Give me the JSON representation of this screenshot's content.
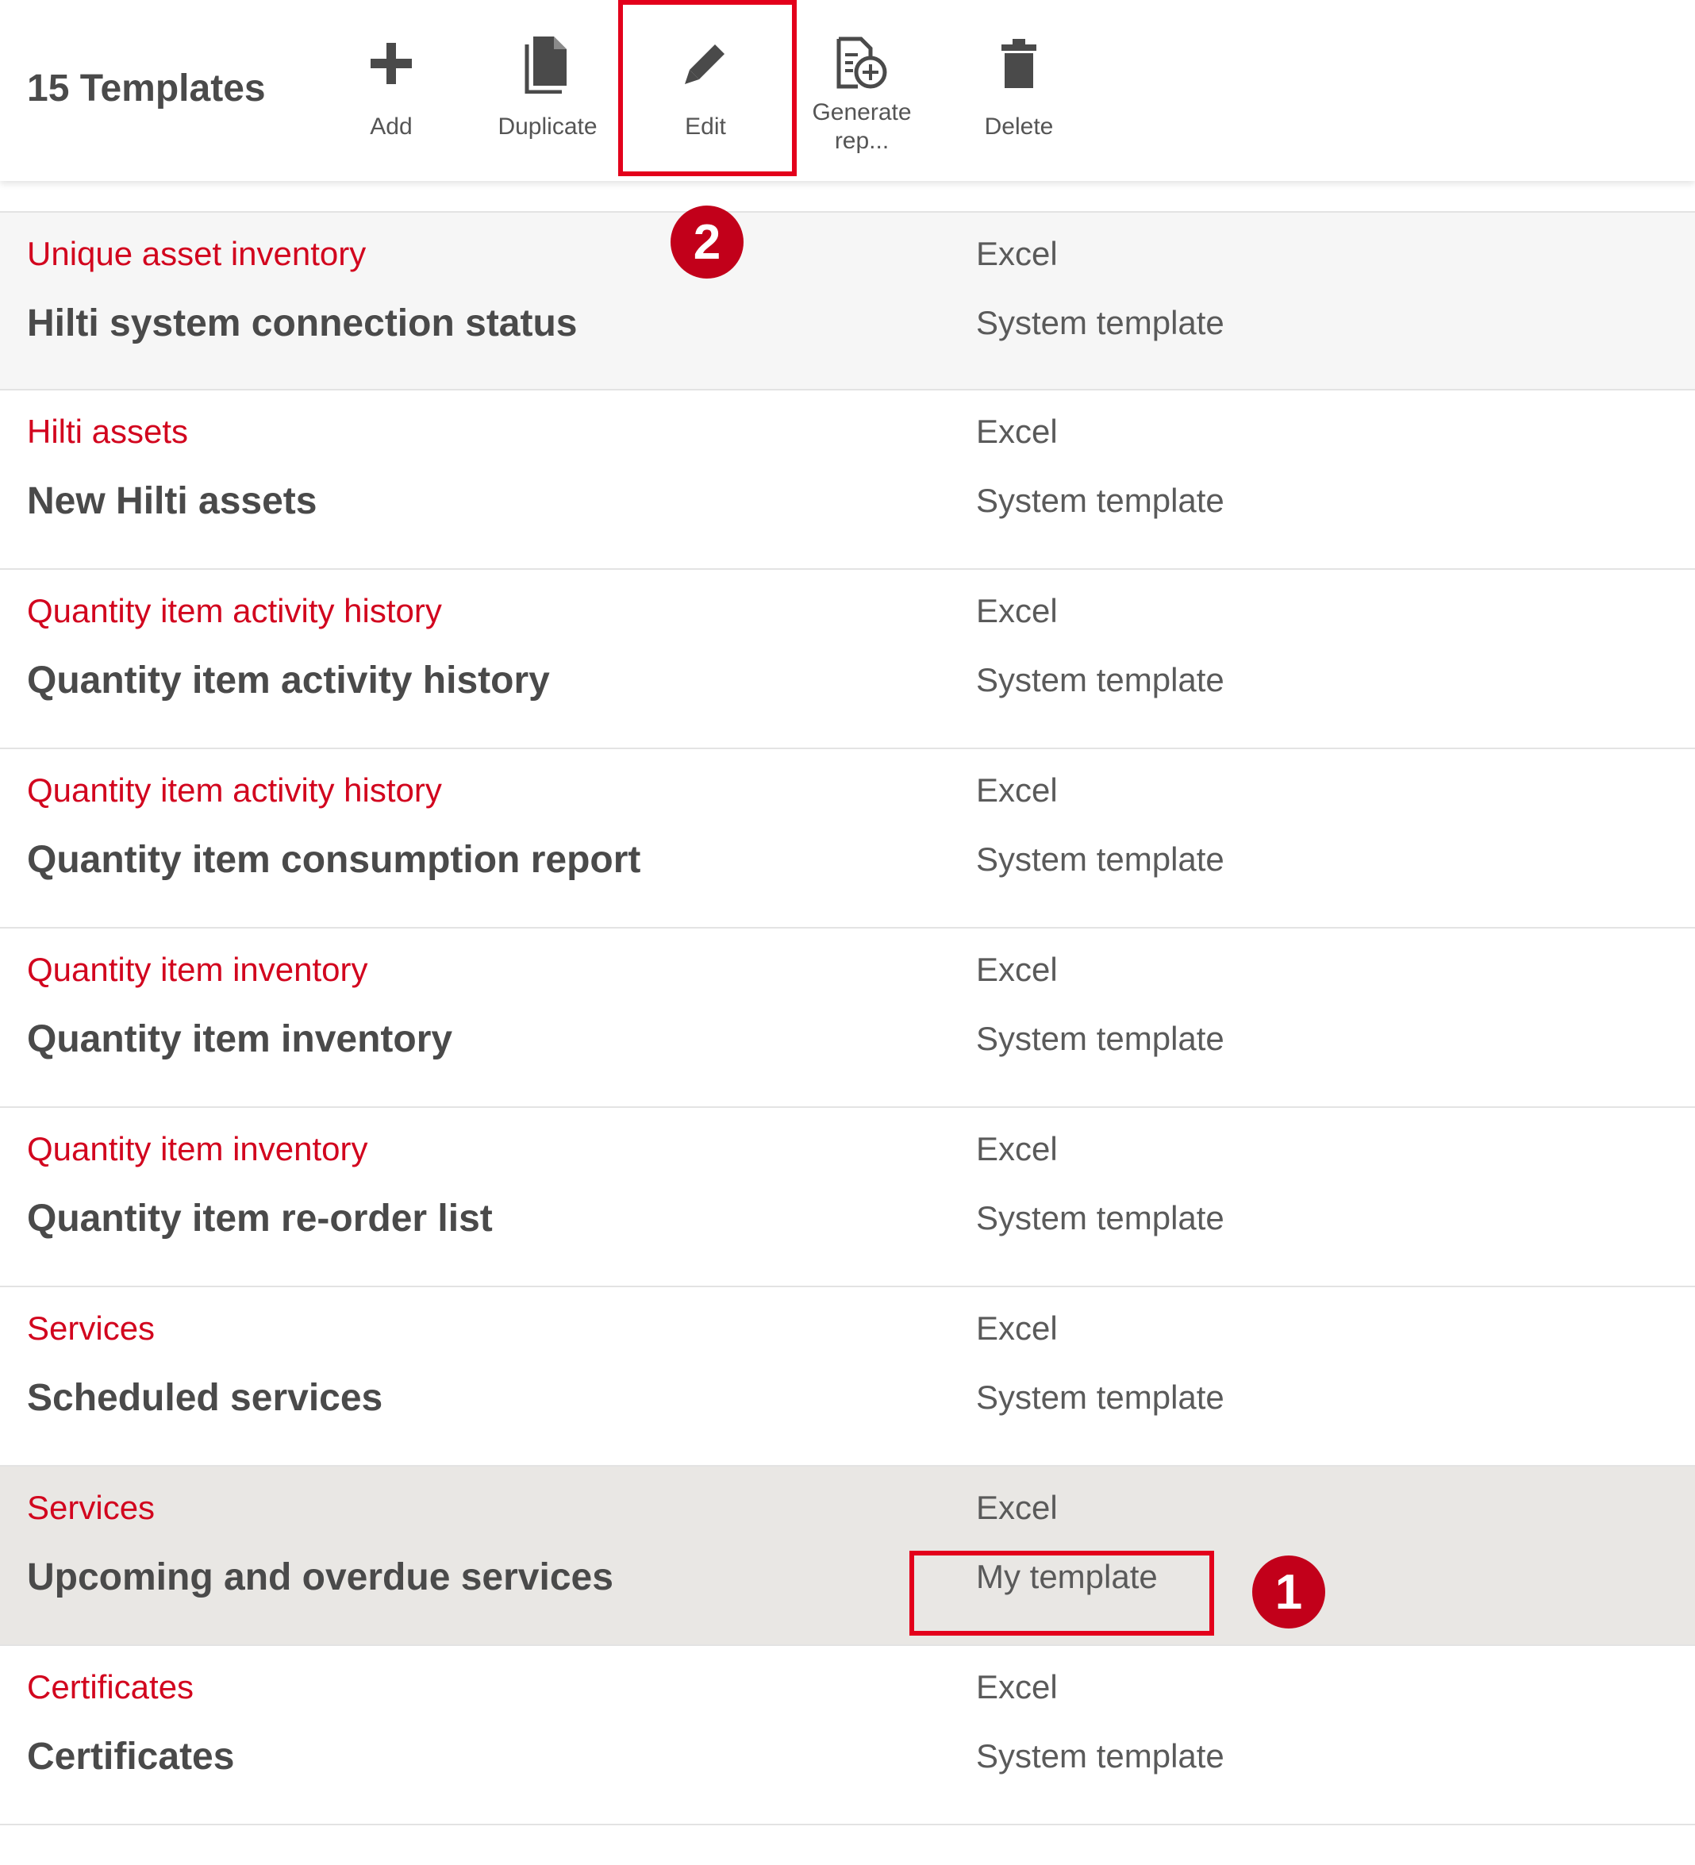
{
  "header": {
    "templates_count": "15 Templates"
  },
  "toolbar": {
    "add_label": "Add",
    "duplicate_label": "Duplicate",
    "edit_label": "Edit",
    "generate_label_line1": "Generate",
    "generate_label_line2": "rep...",
    "delete_label": "Delete"
  },
  "annotations": {
    "step1": "1",
    "step2": "2",
    "highlight_color": "#e3001b"
  },
  "colors": {
    "category_red": "#d2051e",
    "selected_row": "#e9e7e4",
    "badge_red": "#c2001a"
  },
  "templates": [
    {
      "category": "Unique asset inventory",
      "name": "Hilti system connection status",
      "format": "Excel",
      "type": "System template"
    },
    {
      "category": "Hilti assets",
      "name": "New Hilti assets",
      "format": "Excel",
      "type": "System template"
    },
    {
      "category": "Quantity item activity history",
      "name": "Quantity item activity history",
      "format": "Excel",
      "type": "System template"
    },
    {
      "category": "Quantity item activity history",
      "name": "Quantity item consumption report",
      "format": "Excel",
      "type": "System template"
    },
    {
      "category": "Quantity item inventory",
      "name": "Quantity item inventory",
      "format": "Excel",
      "type": "System template"
    },
    {
      "category": "Quantity item inventory",
      "name": "Quantity item re-order list",
      "format": "Excel",
      "type": "System template"
    },
    {
      "category": "Services",
      "name": "Scheduled services",
      "format": "Excel",
      "type": "System template"
    },
    {
      "category": "Services",
      "name": "Upcoming and overdue services",
      "format": "Excel",
      "type": "My template"
    },
    {
      "category": "Certificates",
      "name": "Certificates",
      "format": "Excel",
      "type": "System template"
    }
  ]
}
